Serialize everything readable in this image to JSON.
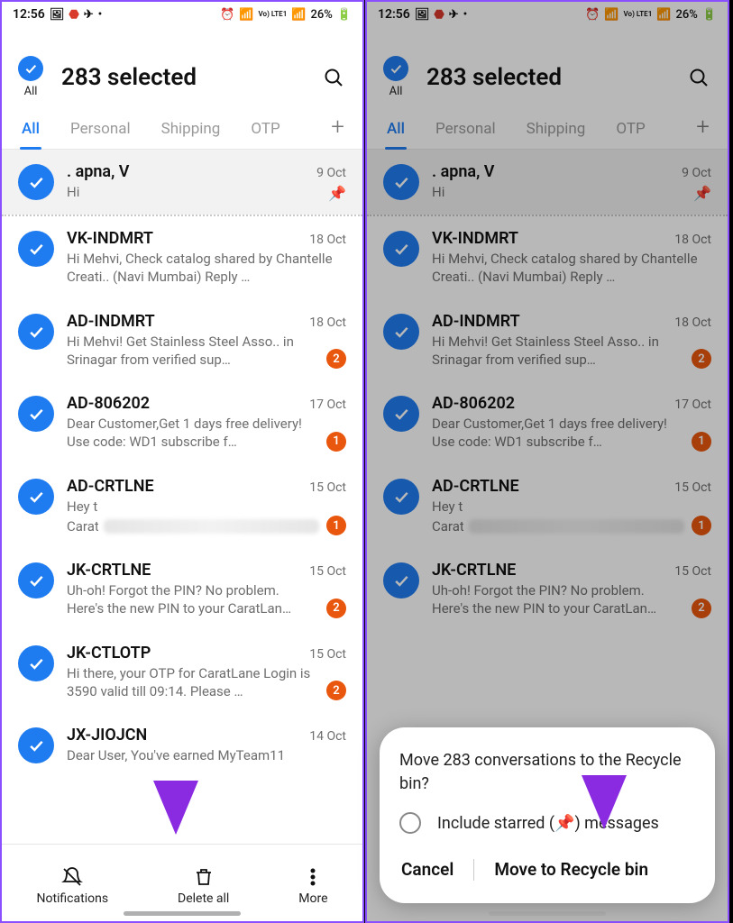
{
  "status": {
    "time": "12:56",
    "battery_pct": "26%",
    "net_label": "Vo) LTE1"
  },
  "header": {
    "all_label": "All",
    "title": "283 selected"
  },
  "tabs": {
    "items": [
      "All",
      "Personal",
      "Shipping",
      "OTP"
    ],
    "active_index": 0
  },
  "messages": [
    {
      "sender": ". apna, V",
      "date": "9 Oct",
      "snippet": "Hi",
      "pinned": true,
      "badge": null,
      "one_line": true
    },
    {
      "sender": "VK-INDMRT",
      "date": "18 Oct",
      "snippet": "Hi Mehvi, Check catalog shared by Chantelle Creati.. (Navi Mumbai)  Reply …",
      "pinned": false,
      "badge": null
    },
    {
      "sender": "AD-INDMRT",
      "date": "18 Oct",
      "snippet": "Hi Mehvi! Get Stainless Steel Asso.. in Srinagar from verified sup…",
      "pinned": false,
      "badge": "2"
    },
    {
      "sender": "AD-806202",
      "date": "17 Oct",
      "snippet": "Dear Customer,Get 1 days free delivery! Use code: WD1 subscribe f…",
      "pinned": false,
      "badge": "1"
    },
    {
      "sender": "AD-CRTLNE",
      "date": "15 Oct",
      "snippet_prefix": "Hey t",
      "snippet_suffix": "Carat",
      "pinned": false,
      "badge": "1",
      "blurred": true
    },
    {
      "sender": "JK-CRTLNE",
      "date": "15 Oct",
      "snippet": "Uh-oh! Forgot the PIN? No problem. Here's the new PIN to your CaratLan…",
      "pinned": false,
      "badge": "2"
    },
    {
      "sender": "JK-CTLOTP",
      "date": "15 Oct",
      "snippet": "Hi there, your OTP for CaratLane Login is 3590 valid till 09:14. Please …",
      "pinned": false,
      "badge": "2"
    },
    {
      "sender": "JX-JIOJCN",
      "date": "14 Oct",
      "snippet": "Dear User,  You've earned MyTeam11",
      "pinned": false,
      "badge": null,
      "one_line": true
    }
  ],
  "bottom_bar": {
    "notifications": "Notifications",
    "delete_all": "Delete all",
    "more": "More"
  },
  "dialog": {
    "message": "Move 283 conversations to the Recycle bin?",
    "include_starred": "Include starred (📌) messages",
    "cancel": "Cancel",
    "confirm": "Move to Recycle bin"
  }
}
